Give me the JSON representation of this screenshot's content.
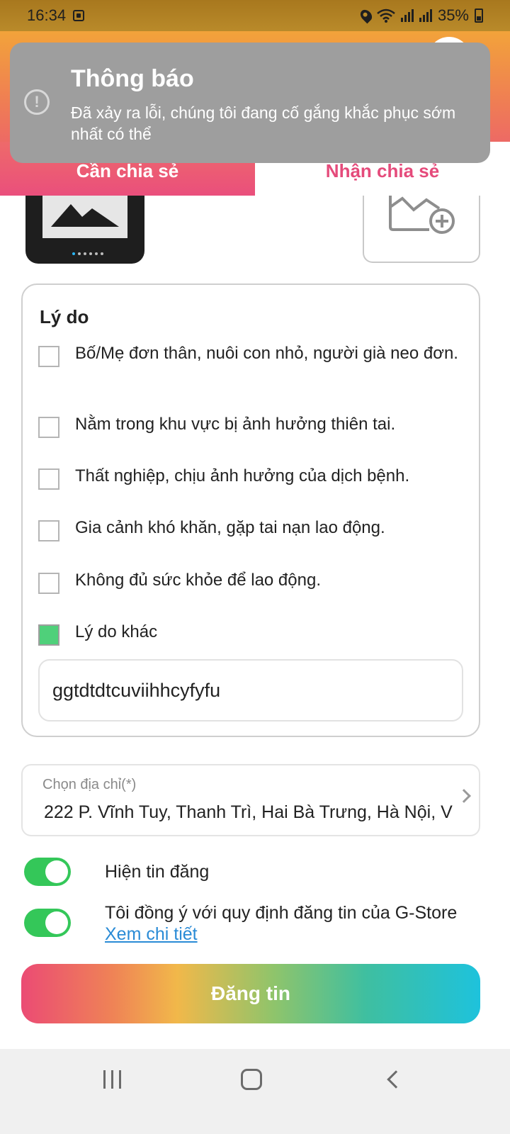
{
  "status_bar": {
    "time": "16:34",
    "battery": "35%"
  },
  "tabs": [
    {
      "label": "Cần chia sẻ",
      "active": true
    },
    {
      "label": "Nhận chia sẻ",
      "active": false
    }
  ],
  "toast": {
    "title": "Thông báo",
    "message": "Đã xảy ra lỗi, chúng tôi đang cố gắng khắc phục sớm nhất có thể",
    "icon": "warning-circle-icon"
  },
  "reasons": {
    "title": "Lý do",
    "options": [
      {
        "label": "Bố/Mẹ đơn thân, nuôi con nhỏ, người già neo đơn.",
        "checked": false
      },
      {
        "label": "Nằm trong khu vực bị ảnh hưởng thiên tai.",
        "checked": false
      },
      {
        "label": "Thất nghiệp, chịu ảnh hưởng của dịch bệnh.",
        "checked": false
      },
      {
        "label": "Gia cảnh khó khăn, gặp tai nạn lao động.",
        "checked": false
      },
      {
        "label": "Không đủ sức khỏe để lao động.",
        "checked": false
      },
      {
        "label": "Lý do khác",
        "checked": true
      }
    ],
    "other_value": "ggtdtdtcuviihhcyfyfu"
  },
  "address": {
    "label": "Chọn địa chỉ(*)",
    "value": "222 P. Vĩnh Tuy, Thanh Trì, Hai Bà Trưng, Hà Nội, V"
  },
  "toggles": {
    "show_post": {
      "label": "Hiện tin đăng",
      "on": true
    },
    "agree": {
      "label": "Tôi đồng ý với quy định đăng tin của G-Store",
      "link": "Xem chi tiết",
      "on": true
    }
  },
  "submit_label": "Đăng tin",
  "colors": {
    "accent": "#e54b7b",
    "toggle_on": "#34c759",
    "checkbox_checked": "#4fd07a",
    "link": "#2a8bd6"
  }
}
